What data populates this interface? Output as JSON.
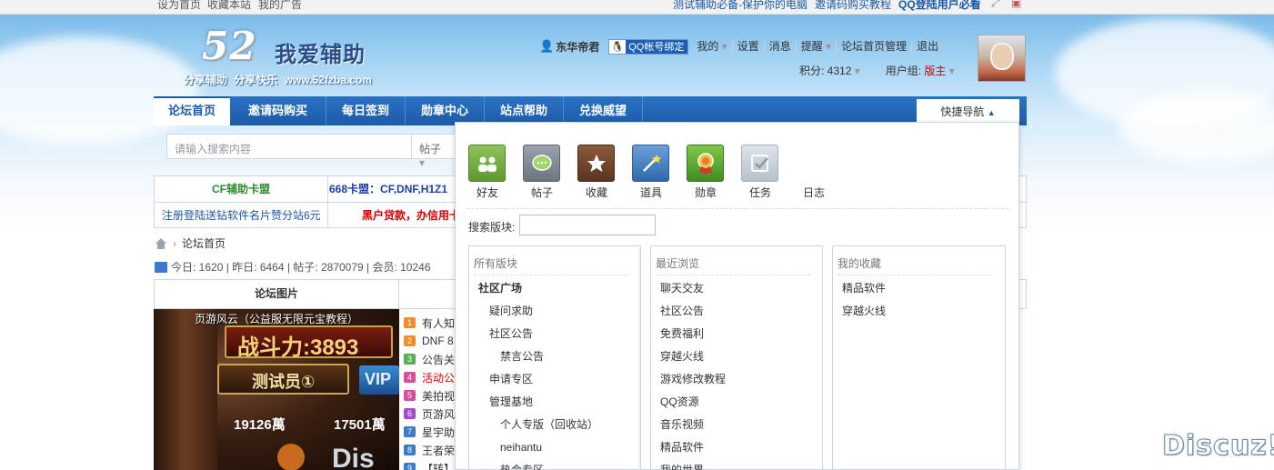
{
  "topbar": {
    "left_links": [
      "设为首页",
      "收藏本站",
      "我的广告"
    ],
    "right_links": [
      "测试辅助必备-保护你的电脑",
      "邀请码购买教程"
    ],
    "right_bold": "QQ登陆用户必看"
  },
  "logo": {
    "number": "52",
    "title": "我爱辅助",
    "slogan": "分享辅助  分享快乐  www.52fzba.com"
  },
  "user": {
    "name": "东华帝君",
    "qq_bind": "QQ帐号绑定",
    "menu": [
      "我的",
      "设置",
      "消息",
      "提醒",
      "论坛首页管理",
      "退出"
    ],
    "score_label": "积分: 4312",
    "group_label": "用户组:",
    "group_value": "版主"
  },
  "nav": {
    "items": [
      "论坛首页",
      "邀请码购买",
      "每日签到",
      "勋章中心",
      "站点帮助",
      "兑换威望"
    ],
    "quick_nav": "快捷导航"
  },
  "search": {
    "placeholder": "请输入搜索内容",
    "type": "帖子"
  },
  "ads": {
    "r1c1": "CF辅助卡盟",
    "r1c2": "668卡盟：CF,DNF,H1Z1",
    "r2c1": "注册登陆送钻软件名片赞分站6元",
    "r2c2": "黑户贷款，办信用卡"
  },
  "breadcrumb": {
    "home": "论坛首页"
  },
  "stats": {
    "text": "今日: 1620 | 昨日: 6464 | 帖子: 2870079 | 会员: 10246"
  },
  "pic_block": {
    "header": "论坛图片",
    "caption": "页游风云（公益服无限元宝教程）",
    "img_text": {
      "power": "战斗力:3893",
      "rank": "测试员①",
      "vip": "VIP",
      "gold1": "19126萬",
      "gold2": "17501萬",
      "dis": "Dis"
    }
  },
  "threads": [
    {
      "num": "1",
      "text": "有人知",
      "color": "#f28c28"
    },
    {
      "num": "2",
      "text": "DNF 8",
      "color": "#f28c28"
    },
    {
      "num": "3",
      "text": "公告关",
      "color": "#58b04f"
    },
    {
      "num": "4",
      "text": "活动公",
      "color": "#d84c9a",
      "red": true
    },
    {
      "num": "5",
      "text": "美拍视",
      "color": "#d84c9a"
    },
    {
      "num": "6",
      "text": "页游风",
      "color": "#a64cc9"
    },
    {
      "num": "7",
      "text": "星宇助",
      "color": "#3b7bc8"
    },
    {
      "num": "8",
      "text": "王者荣",
      "color": "#3b7bc8"
    },
    {
      "num": "9",
      "text": "【转】",
      "color": "#3b7bc8"
    }
  ],
  "dropdown": {
    "quick_icons": [
      {
        "label": "好友",
        "icon": "friends-icon"
      },
      {
        "label": "帖子",
        "icon": "thread-icon"
      },
      {
        "label": "收藏",
        "icon": "favorite-icon"
      },
      {
        "label": "道具",
        "icon": "magic-wand-icon"
      },
      {
        "label": "勋章",
        "icon": "medal-icon"
      },
      {
        "label": "任务",
        "icon": "task-icon"
      },
      {
        "label": "日志",
        "icon": "blog-icon"
      }
    ],
    "forum_search_label": "搜索版块:",
    "all_forums": {
      "title": "所有版块",
      "items": [
        "社区广场",
        "疑问求助",
        "社区公告",
        "禁言公告",
        "申请专区",
        "管理基地",
        "个人专版（回收站）",
        "neihantu",
        "热会专区"
      ]
    },
    "recent": {
      "title": "最近浏览",
      "items": [
        "聊天交友",
        "社区公告",
        "免费福利",
        "穿越火线",
        "游戏修改教程",
        "QQ资源",
        "音乐视频",
        "精品软件",
        "我的世界"
      ]
    },
    "favorites": {
      "title": "我的收藏",
      "items": [
        "精品软件",
        "穿越火线"
      ]
    }
  },
  "watermark": "Discuz!",
  "colors": {
    "nav_blue": "#1c5ba8",
    "arrow_red": "#e8413a",
    "accent_red": "#d40000"
  }
}
